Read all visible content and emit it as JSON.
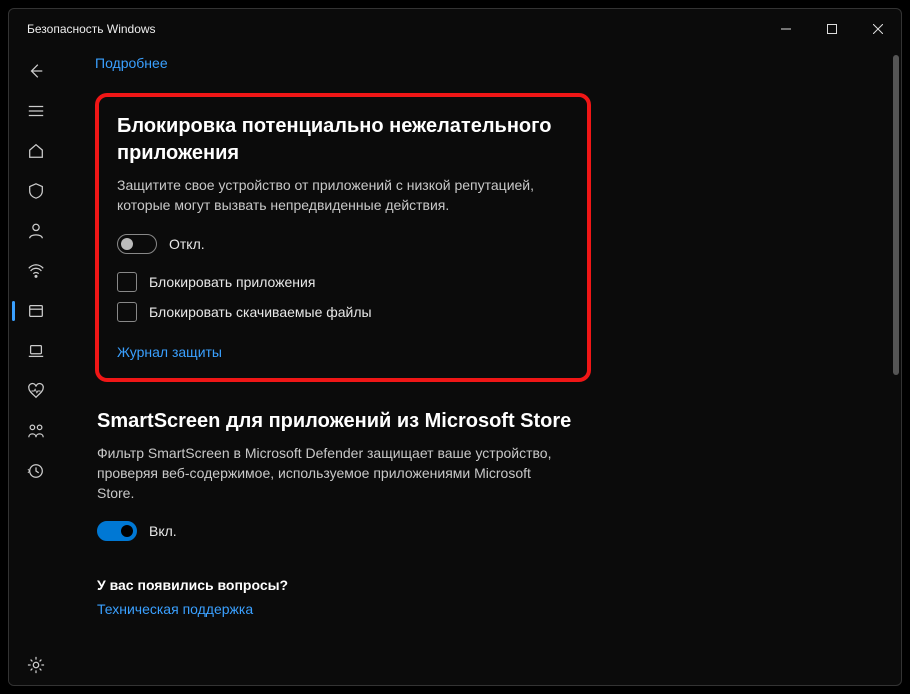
{
  "titlebar": {
    "title": "Безопасность Windows"
  },
  "sidebar": {
    "items": [
      {
        "name": "back"
      },
      {
        "name": "menu"
      },
      {
        "name": "home"
      },
      {
        "name": "shield"
      },
      {
        "name": "account"
      },
      {
        "name": "firewall"
      },
      {
        "name": "app-browser",
        "active": true
      },
      {
        "name": "device"
      },
      {
        "name": "performance"
      },
      {
        "name": "family"
      },
      {
        "name": "history"
      }
    ]
  },
  "main": {
    "top_link": "Подробнее",
    "section1": {
      "title": "Блокировка потенциально нежелательного приложения",
      "desc": "Защитите свое устройство от приложений с низкой репутацией, которые могут вызвать непредвиденные действия.",
      "toggle_label": "Откл.",
      "toggle_on": false,
      "check1": "Блокировать приложения",
      "check2": "Блокировать скачиваемые файлы",
      "link": "Журнал защиты"
    },
    "section2": {
      "title": "SmartScreen для приложений из Microsoft Store",
      "desc": "Фильтр SmartScreen в Microsoft Defender защищает ваше устройство, проверяя веб-содержимое, используемое приложениями Microsoft Store.",
      "toggle_label": "Вкл.",
      "toggle_on": true
    },
    "questions": {
      "title": "У вас появились вопросы?",
      "link": "Техническая поддержка"
    }
  }
}
